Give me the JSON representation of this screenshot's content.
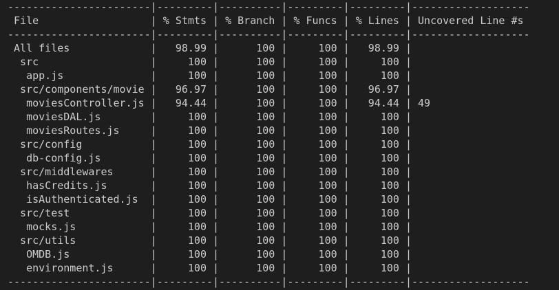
{
  "header": [
    "File",
    "% Stmts",
    "% Branch",
    "% Funcs",
    "% Lines",
    "Uncovered Line #s"
  ],
  "rows": [
    {
      "file": "All files",
      "indent": 0,
      "stmts": "98.99",
      "branch": "100",
      "funcs": "100",
      "lines": "98.99",
      "uncovered": ""
    },
    {
      "file": "src",
      "indent": 1,
      "stmts": "100",
      "branch": "100",
      "funcs": "100",
      "lines": "100",
      "uncovered": ""
    },
    {
      "file": "app.js",
      "indent": 2,
      "stmts": "100",
      "branch": "100",
      "funcs": "100",
      "lines": "100",
      "uncovered": ""
    },
    {
      "file": "src/components/movies",
      "indent": 1,
      "stmts": "96.97",
      "branch": "100",
      "funcs": "100",
      "lines": "96.97",
      "uncovered": ""
    },
    {
      "file": "moviesController.js",
      "indent": 2,
      "stmts": "94.44",
      "branch": "100",
      "funcs": "100",
      "lines": "94.44",
      "uncovered": "49"
    },
    {
      "file": "moviesDAL.js",
      "indent": 2,
      "stmts": "100",
      "branch": "100",
      "funcs": "100",
      "lines": "100",
      "uncovered": ""
    },
    {
      "file": "moviesRoutes.js",
      "indent": 2,
      "stmts": "100",
      "branch": "100",
      "funcs": "100",
      "lines": "100",
      "uncovered": ""
    },
    {
      "file": "src/config",
      "indent": 1,
      "stmts": "100",
      "branch": "100",
      "funcs": "100",
      "lines": "100",
      "uncovered": ""
    },
    {
      "file": "db-config.js",
      "indent": 2,
      "stmts": "100",
      "branch": "100",
      "funcs": "100",
      "lines": "100",
      "uncovered": ""
    },
    {
      "file": "src/middlewares",
      "indent": 1,
      "stmts": "100",
      "branch": "100",
      "funcs": "100",
      "lines": "100",
      "uncovered": ""
    },
    {
      "file": "hasCredits.js",
      "indent": 2,
      "stmts": "100",
      "branch": "100",
      "funcs": "100",
      "lines": "100",
      "uncovered": ""
    },
    {
      "file": "isAuthenticated.js",
      "indent": 2,
      "stmts": "100",
      "branch": "100",
      "funcs": "100",
      "lines": "100",
      "uncovered": ""
    },
    {
      "file": "src/test",
      "indent": 1,
      "stmts": "100",
      "branch": "100",
      "funcs": "100",
      "lines": "100",
      "uncovered": ""
    },
    {
      "file": "mocks.js",
      "indent": 2,
      "stmts": "100",
      "branch": "100",
      "funcs": "100",
      "lines": "100",
      "uncovered": ""
    },
    {
      "file": "src/utils",
      "indent": 1,
      "stmts": "100",
      "branch": "100",
      "funcs": "100",
      "lines": "100",
      "uncovered": ""
    },
    {
      "file": "OMDB.js",
      "indent": 2,
      "stmts": "100",
      "branch": "100",
      "funcs": "100",
      "lines": "100",
      "uncovered": ""
    },
    {
      "file": "environment.js",
      "indent": 2,
      "stmts": "100",
      "branch": "100",
      "funcs": "100",
      "lines": "100",
      "uncovered": ""
    }
  ],
  "colors": {
    "background": "#1e1e1e",
    "text": "#cccccc"
  }
}
